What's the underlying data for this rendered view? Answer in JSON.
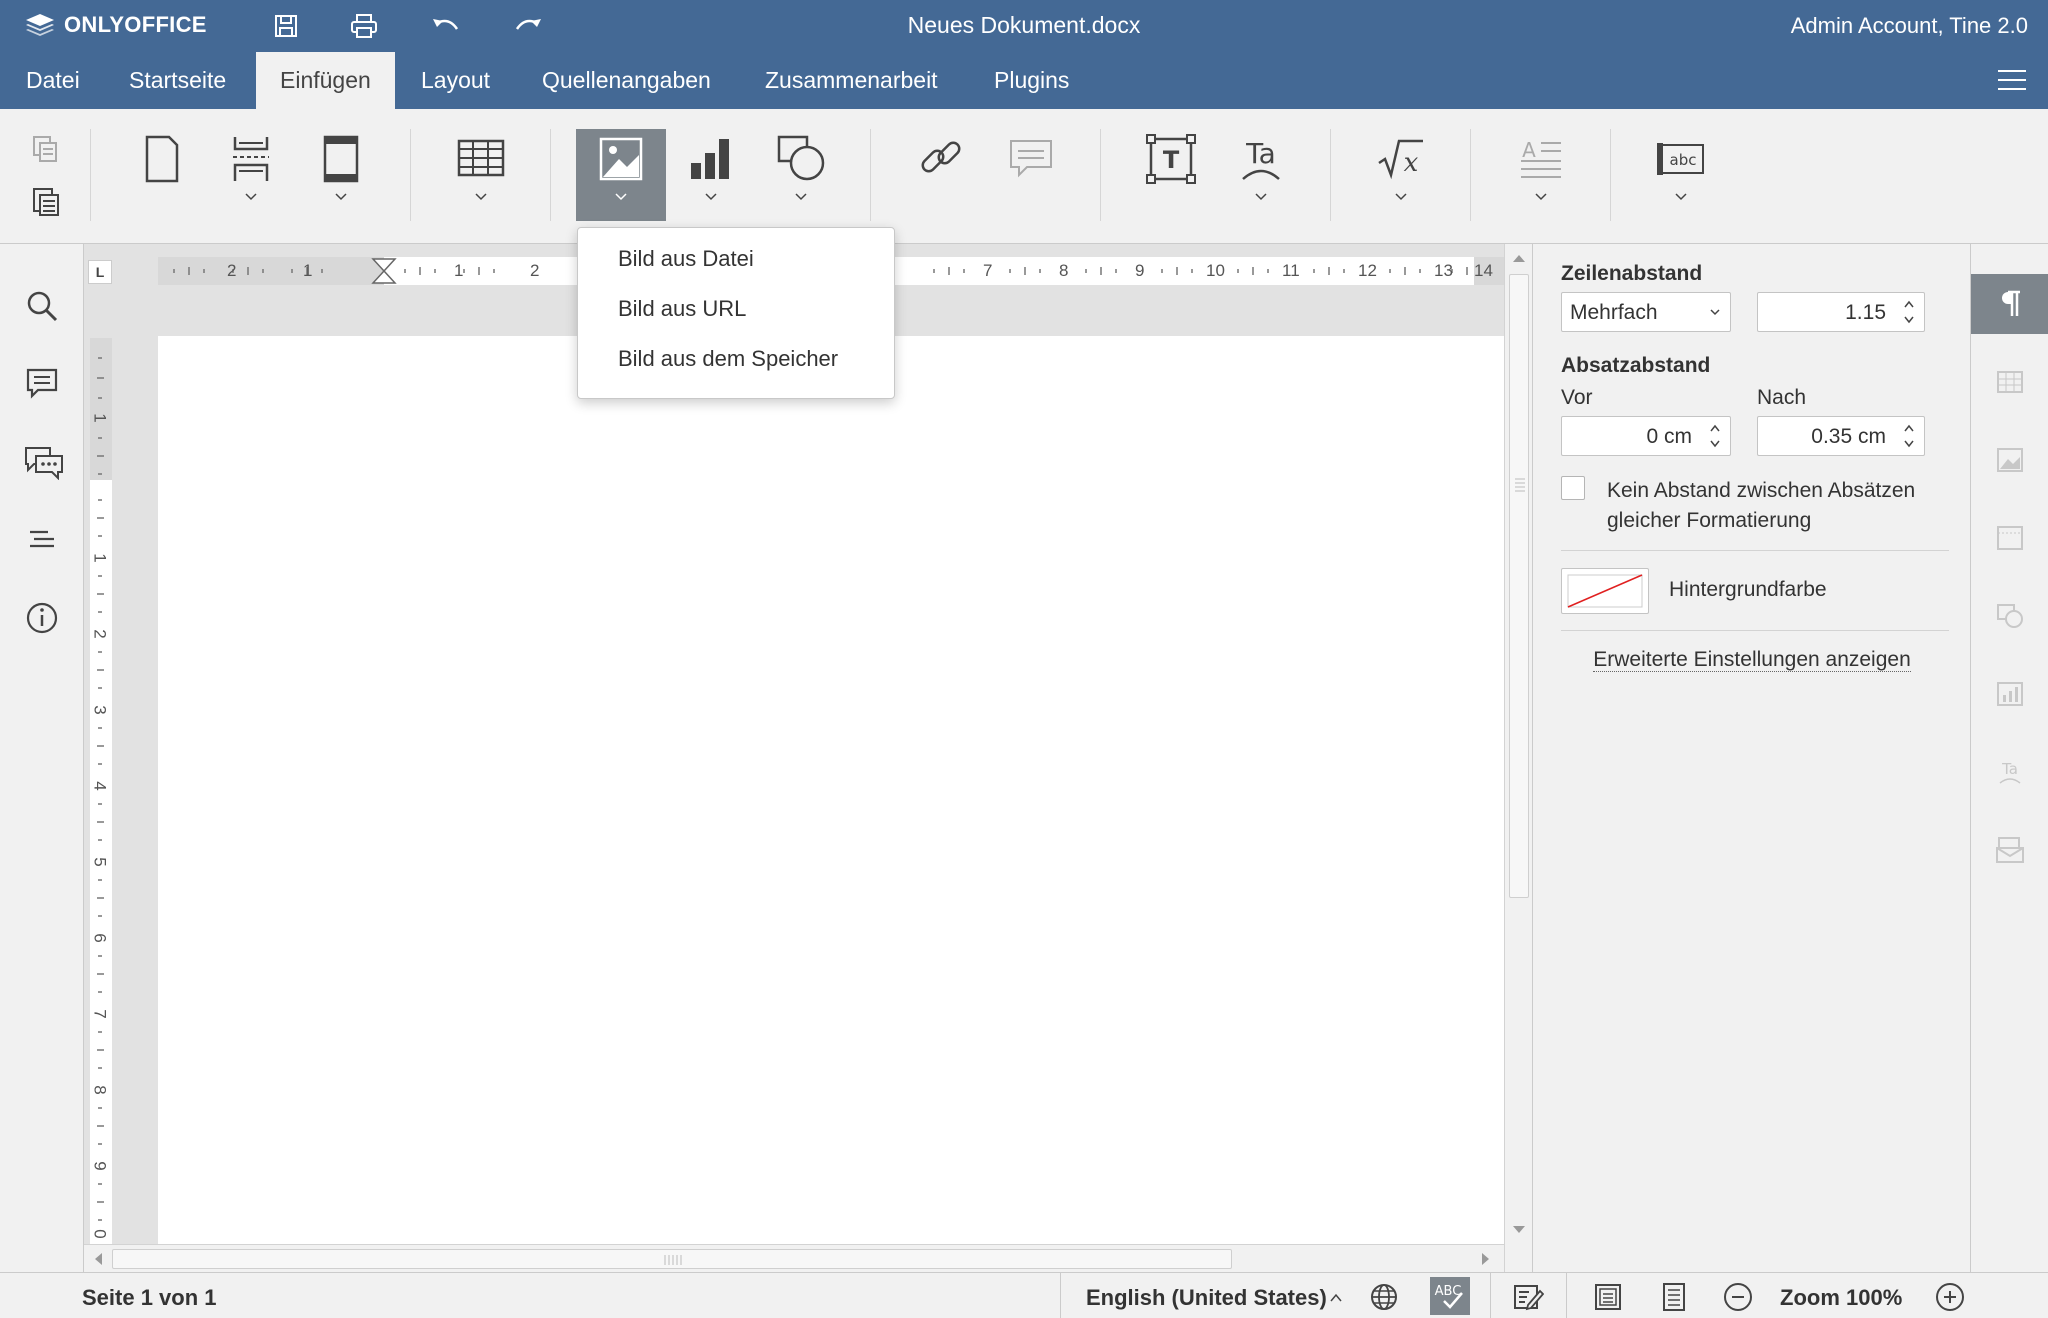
{
  "app": {
    "logo": "ONLYOFFICE",
    "doc_title": "Neues Dokument.docx",
    "user": "Admin Account, Tine 2.0"
  },
  "tabs": [
    {
      "label": "Datei"
    },
    {
      "label": "Startseite"
    },
    {
      "label": "Einfügen"
    },
    {
      "label": "Layout"
    },
    {
      "label": "Quellenangaben"
    },
    {
      "label": "Zusammenarbeit"
    },
    {
      "label": "Plugins"
    }
  ],
  "active_tab": "Einfügen",
  "image_menu": {
    "items": [
      "Bild aus Datei",
      "Bild aus URL",
      "Bild aus dem Speicher"
    ]
  },
  "ruler": {
    "h_labels": [
      "2",
      "1",
      "1",
      "2",
      "7",
      "8",
      "9",
      "10",
      "11",
      "12",
      "13",
      "14"
    ],
    "v_labels": [
      "1",
      "1",
      "2",
      "3",
      "4",
      "5",
      "6",
      "7",
      "8",
      "9",
      "0"
    ],
    "corner": "L"
  },
  "panel": {
    "line_spacing_label": "Zeilenabstand",
    "line_spacing_mode": "Mehrfach",
    "line_spacing_value": "1.15",
    "para_spacing_label": "Absatzabstand",
    "before_label": "Vor",
    "after_label": "Nach",
    "before_value": "0 cm",
    "after_value": "0.35 cm",
    "no_spacing_line1": "Kein Abstand zwischen Absätzen",
    "no_spacing_line2": "gleicher Formatierung",
    "no_spacing_checked": false,
    "background_label": "Hintergrundfarbe",
    "advanced_link": "Erweiterte Einstellungen anzeigen"
  },
  "status": {
    "page": "Seite 1 von 1",
    "language": "English (United States)",
    "zoom": "Zoom 100%"
  },
  "colors": {
    "header": "#446995",
    "toolbar": "#f1f1f1",
    "pressed": "#7d858c"
  }
}
